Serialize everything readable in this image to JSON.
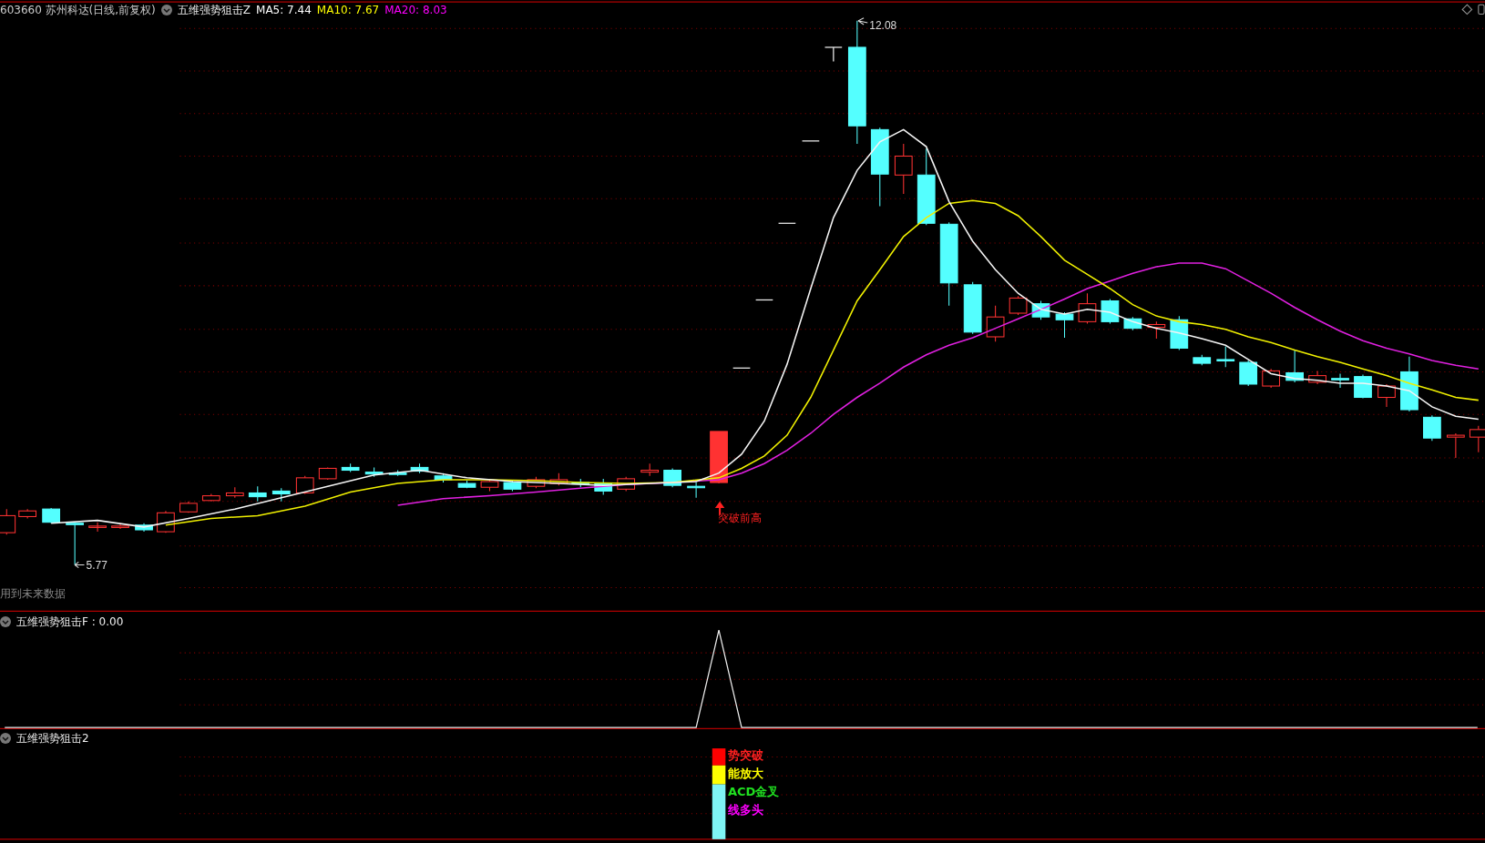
{
  "header": {
    "symbol": "603660 苏州科达(日线,前复权)",
    "indicator": "五维强势狙击Z",
    "averages": [
      {
        "label": "MA5: 7.44",
        "color": "#ffffff"
      },
      {
        "label": "MA10: 7.67",
        "color": "#ffff00"
      },
      {
        "label": "MA20: 8.03",
        "color": "#ff00ff"
      }
    ]
  },
  "main_chart": {
    "high_label": "12.08",
    "low_label": "5.77",
    "signal_label": "突破前高",
    "note": "用到未来数据"
  },
  "panel_f": {
    "title": "五维强势狙击F : 0.00"
  },
  "panel_2": {
    "title": "五维强势狙击2",
    "signals": [
      {
        "label": "势突破",
        "color": "#ff2020"
      },
      {
        "label": "能放大",
        "color": "#ffff00"
      },
      {
        "label": "ACD金叉",
        "color": "#20e020"
      },
      {
        "label": "线多头",
        "color": "#ff00ff"
      }
    ]
  }
}
